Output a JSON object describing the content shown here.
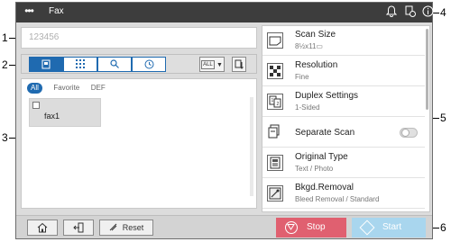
{
  "callouts": [
    "1",
    "2",
    "3",
    "4",
    "5",
    "6"
  ],
  "header": {
    "menu_glyph": "•••",
    "title": "Fax",
    "icons": [
      "bell-icon",
      "job-status-icon",
      "info-icon"
    ]
  },
  "destination": {
    "value": "123456"
  },
  "toolbar": {
    "segments": [
      "address-book-icon",
      "keypad-icon",
      "search-icon",
      "history-icon"
    ],
    "active_index": 0,
    "filter_label": "ALL",
    "filter_icon": "chevron-down-icon",
    "extra_icon": "sort-icon"
  },
  "address_book": {
    "tabs": [
      "All",
      "Favorite",
      "DEF"
    ],
    "active_tab": "All",
    "entries": [
      {
        "name": "fax1",
        "checked": false
      }
    ]
  },
  "settings": [
    {
      "title": "Scan Size",
      "value": "8½x11▭",
      "icon": "scan-size-icon"
    },
    {
      "title": "Resolution",
      "value": "Fine",
      "icon": "resolution-icon"
    },
    {
      "title": "Duplex Settings",
      "value": "1-Sided",
      "icon": "duplex-icon"
    },
    {
      "title": "Separate Scan",
      "value": "",
      "icon": "separate-scan-icon",
      "toggle": false
    },
    {
      "title": "Original Type",
      "value": "Text / Photo",
      "icon": "original-type-icon"
    },
    {
      "title": "Bkgd.Removal",
      "value": "Bleed Removal / Standard",
      "icon": "background-removal-icon"
    }
  ],
  "footer": {
    "home_icon": "home-icon",
    "logout_icon": "logout-icon",
    "reset_label": "Reset",
    "stop_label": "Stop",
    "start_label": "Start",
    "colors": {
      "stop": "#e06070",
      "start": "#a9d6ee",
      "accent": "#1f6ab0"
    }
  }
}
